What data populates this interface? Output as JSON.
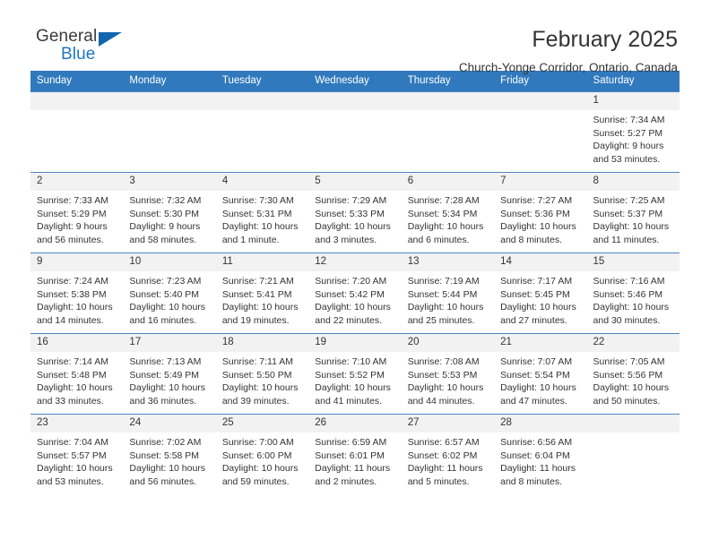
{
  "brand": {
    "name_part1": "General",
    "name_part2": "Blue"
  },
  "header": {
    "title": "February 2025",
    "location": "Church-Yonge Corridor, Ontario, Canada"
  },
  "calendar": {
    "weekday_headers": [
      "Sunday",
      "Monday",
      "Tuesday",
      "Wednesday",
      "Thursday",
      "Friday",
      "Saturday"
    ],
    "accent_color": "#3179bd",
    "daynum_band_color": "#f2f2f2",
    "row_divider_color": "#4b86c4",
    "weeks": [
      [
        {
          "day": "",
          "sunrise": "",
          "sunset": "",
          "daylight_line1": "",
          "daylight_line2": ""
        },
        {
          "day": "",
          "sunrise": "",
          "sunset": "",
          "daylight_line1": "",
          "daylight_line2": ""
        },
        {
          "day": "",
          "sunrise": "",
          "sunset": "",
          "daylight_line1": "",
          "daylight_line2": ""
        },
        {
          "day": "",
          "sunrise": "",
          "sunset": "",
          "daylight_line1": "",
          "daylight_line2": ""
        },
        {
          "day": "",
          "sunrise": "",
          "sunset": "",
          "daylight_line1": "",
          "daylight_line2": ""
        },
        {
          "day": "",
          "sunrise": "",
          "sunset": "",
          "daylight_line1": "",
          "daylight_line2": ""
        },
        {
          "day": "1",
          "sunrise": "Sunrise: 7:34 AM",
          "sunset": "Sunset: 5:27 PM",
          "daylight_line1": "Daylight: 9 hours",
          "daylight_line2": "and 53 minutes."
        }
      ],
      [
        {
          "day": "2",
          "sunrise": "Sunrise: 7:33 AM",
          "sunset": "Sunset: 5:29 PM",
          "daylight_line1": "Daylight: 9 hours",
          "daylight_line2": "and 56 minutes."
        },
        {
          "day": "3",
          "sunrise": "Sunrise: 7:32 AM",
          "sunset": "Sunset: 5:30 PM",
          "daylight_line1": "Daylight: 9 hours",
          "daylight_line2": "and 58 minutes."
        },
        {
          "day": "4",
          "sunrise": "Sunrise: 7:30 AM",
          "sunset": "Sunset: 5:31 PM",
          "daylight_line1": "Daylight: 10 hours",
          "daylight_line2": "and 1 minute."
        },
        {
          "day": "5",
          "sunrise": "Sunrise: 7:29 AM",
          "sunset": "Sunset: 5:33 PM",
          "daylight_line1": "Daylight: 10 hours",
          "daylight_line2": "and 3 minutes."
        },
        {
          "day": "6",
          "sunrise": "Sunrise: 7:28 AM",
          "sunset": "Sunset: 5:34 PM",
          "daylight_line1": "Daylight: 10 hours",
          "daylight_line2": "and 6 minutes."
        },
        {
          "day": "7",
          "sunrise": "Sunrise: 7:27 AM",
          "sunset": "Sunset: 5:36 PM",
          "daylight_line1": "Daylight: 10 hours",
          "daylight_line2": "and 8 minutes."
        },
        {
          "day": "8",
          "sunrise": "Sunrise: 7:25 AM",
          "sunset": "Sunset: 5:37 PM",
          "daylight_line1": "Daylight: 10 hours",
          "daylight_line2": "and 11 minutes."
        }
      ],
      [
        {
          "day": "9",
          "sunrise": "Sunrise: 7:24 AM",
          "sunset": "Sunset: 5:38 PM",
          "daylight_line1": "Daylight: 10 hours",
          "daylight_line2": "and 14 minutes."
        },
        {
          "day": "10",
          "sunrise": "Sunrise: 7:23 AM",
          "sunset": "Sunset: 5:40 PM",
          "daylight_line1": "Daylight: 10 hours",
          "daylight_line2": "and 16 minutes."
        },
        {
          "day": "11",
          "sunrise": "Sunrise: 7:21 AM",
          "sunset": "Sunset: 5:41 PM",
          "daylight_line1": "Daylight: 10 hours",
          "daylight_line2": "and 19 minutes."
        },
        {
          "day": "12",
          "sunrise": "Sunrise: 7:20 AM",
          "sunset": "Sunset: 5:42 PM",
          "daylight_line1": "Daylight: 10 hours",
          "daylight_line2": "and 22 minutes."
        },
        {
          "day": "13",
          "sunrise": "Sunrise: 7:19 AM",
          "sunset": "Sunset: 5:44 PM",
          "daylight_line1": "Daylight: 10 hours",
          "daylight_line2": "and 25 minutes."
        },
        {
          "day": "14",
          "sunrise": "Sunrise: 7:17 AM",
          "sunset": "Sunset: 5:45 PM",
          "daylight_line1": "Daylight: 10 hours",
          "daylight_line2": "and 27 minutes."
        },
        {
          "day": "15",
          "sunrise": "Sunrise: 7:16 AM",
          "sunset": "Sunset: 5:46 PM",
          "daylight_line1": "Daylight: 10 hours",
          "daylight_line2": "and 30 minutes."
        }
      ],
      [
        {
          "day": "16",
          "sunrise": "Sunrise: 7:14 AM",
          "sunset": "Sunset: 5:48 PM",
          "daylight_line1": "Daylight: 10 hours",
          "daylight_line2": "and 33 minutes."
        },
        {
          "day": "17",
          "sunrise": "Sunrise: 7:13 AM",
          "sunset": "Sunset: 5:49 PM",
          "daylight_line1": "Daylight: 10 hours",
          "daylight_line2": "and 36 minutes."
        },
        {
          "day": "18",
          "sunrise": "Sunrise: 7:11 AM",
          "sunset": "Sunset: 5:50 PM",
          "daylight_line1": "Daylight: 10 hours",
          "daylight_line2": "and 39 minutes."
        },
        {
          "day": "19",
          "sunrise": "Sunrise: 7:10 AM",
          "sunset": "Sunset: 5:52 PM",
          "daylight_line1": "Daylight: 10 hours",
          "daylight_line2": "and 41 minutes."
        },
        {
          "day": "20",
          "sunrise": "Sunrise: 7:08 AM",
          "sunset": "Sunset: 5:53 PM",
          "daylight_line1": "Daylight: 10 hours",
          "daylight_line2": "and 44 minutes."
        },
        {
          "day": "21",
          "sunrise": "Sunrise: 7:07 AM",
          "sunset": "Sunset: 5:54 PM",
          "daylight_line1": "Daylight: 10 hours",
          "daylight_line2": "and 47 minutes."
        },
        {
          "day": "22",
          "sunrise": "Sunrise: 7:05 AM",
          "sunset": "Sunset: 5:56 PM",
          "daylight_line1": "Daylight: 10 hours",
          "daylight_line2": "and 50 minutes."
        }
      ],
      [
        {
          "day": "23",
          "sunrise": "Sunrise: 7:04 AM",
          "sunset": "Sunset: 5:57 PM",
          "daylight_line1": "Daylight: 10 hours",
          "daylight_line2": "and 53 minutes."
        },
        {
          "day": "24",
          "sunrise": "Sunrise: 7:02 AM",
          "sunset": "Sunset: 5:58 PM",
          "daylight_line1": "Daylight: 10 hours",
          "daylight_line2": "and 56 minutes."
        },
        {
          "day": "25",
          "sunrise": "Sunrise: 7:00 AM",
          "sunset": "Sunset: 6:00 PM",
          "daylight_line1": "Daylight: 10 hours",
          "daylight_line2": "and 59 minutes."
        },
        {
          "day": "26",
          "sunrise": "Sunrise: 6:59 AM",
          "sunset": "Sunset: 6:01 PM",
          "daylight_line1": "Daylight: 11 hours",
          "daylight_line2": "and 2 minutes."
        },
        {
          "day": "27",
          "sunrise": "Sunrise: 6:57 AM",
          "sunset": "Sunset: 6:02 PM",
          "daylight_line1": "Daylight: 11 hours",
          "daylight_line2": "and 5 minutes."
        },
        {
          "day": "28",
          "sunrise": "Sunrise: 6:56 AM",
          "sunset": "Sunset: 6:04 PM",
          "daylight_line1": "Daylight: 11 hours",
          "daylight_line2": "and 8 minutes."
        },
        {
          "day": "",
          "sunrise": "",
          "sunset": "",
          "daylight_line1": "",
          "daylight_line2": ""
        }
      ]
    ]
  }
}
